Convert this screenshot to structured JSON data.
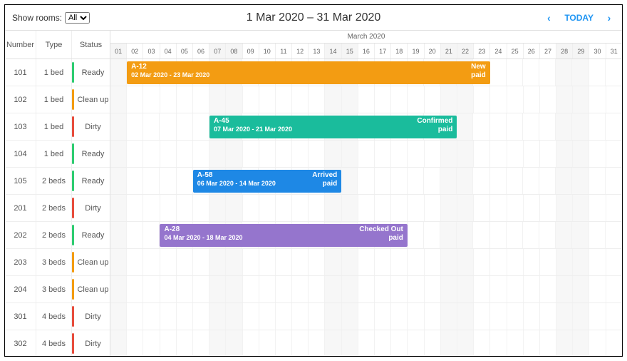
{
  "toolbar": {
    "filter_label": "Show rooms:",
    "filter_value": "All",
    "title": "1 Mar 2020 – 31 Mar 2020",
    "today_label": "TODAY"
  },
  "month_label": "March 2020",
  "columns": {
    "number": "Number",
    "type": "Type",
    "status": "Status"
  },
  "days": [
    {
      "d": "01",
      "we": true
    },
    {
      "d": "02",
      "we": false
    },
    {
      "d": "03",
      "we": false
    },
    {
      "d": "04",
      "we": false
    },
    {
      "d": "05",
      "we": false
    },
    {
      "d": "06",
      "we": false
    },
    {
      "d": "07",
      "we": true
    },
    {
      "d": "08",
      "we": true
    },
    {
      "d": "09",
      "we": false
    },
    {
      "d": "10",
      "we": false
    },
    {
      "d": "11",
      "we": false
    },
    {
      "d": "12",
      "we": false
    },
    {
      "d": "13",
      "we": false
    },
    {
      "d": "14",
      "we": true
    },
    {
      "d": "15",
      "we": true
    },
    {
      "d": "16",
      "we": false
    },
    {
      "d": "17",
      "we": false
    },
    {
      "d": "18",
      "we": false
    },
    {
      "d": "19",
      "we": false
    },
    {
      "d": "20",
      "we": false
    },
    {
      "d": "21",
      "we": true
    },
    {
      "d": "22",
      "we": true
    },
    {
      "d": "23",
      "we": false
    },
    {
      "d": "24",
      "we": false
    },
    {
      "d": "25",
      "we": false
    },
    {
      "d": "26",
      "we": false
    },
    {
      "d": "27",
      "we": false
    },
    {
      "d": "28",
      "we": true
    },
    {
      "d": "29",
      "we": true
    },
    {
      "d": "30",
      "we": false
    },
    {
      "d": "31",
      "we": false
    }
  ],
  "status_colors": {
    "Ready": "#2ecc71",
    "Clean up": "#f39c12",
    "Dirty": "#e74c3c"
  },
  "rooms": [
    {
      "number": "101",
      "type": "1 bed",
      "status": "Ready"
    },
    {
      "number": "102",
      "type": "1 bed",
      "status": "Clean up"
    },
    {
      "number": "103",
      "type": "1 bed",
      "status": "Dirty"
    },
    {
      "number": "104",
      "type": "1 bed",
      "status": "Ready"
    },
    {
      "number": "105",
      "type": "2 beds",
      "status": "Ready"
    },
    {
      "number": "201",
      "type": "2 beds",
      "status": "Dirty"
    },
    {
      "number": "202",
      "type": "2 beds",
      "status": "Ready"
    },
    {
      "number": "203",
      "type": "3 beds",
      "status": "Clean up"
    },
    {
      "number": "204",
      "type": "3 beds",
      "status": "Clean up"
    },
    {
      "number": "301",
      "type": "4 beds",
      "status": "Dirty"
    },
    {
      "number": "302",
      "type": "4 beds",
      "status": "Dirty"
    }
  ],
  "bookings": [
    {
      "room_index": 0,
      "start": 2,
      "end": 23,
      "id": "A-12",
      "dates": "02 Mar 2020 - 23 Mar 2020",
      "status": "New",
      "payment": "paid",
      "color": "#f39c12"
    },
    {
      "room_index": 2,
      "start": 7,
      "end": 21,
      "id": "A-45",
      "dates": "07 Mar 2020 - 21 Mar 2020",
      "status": "Confirmed",
      "payment": "paid",
      "color": "#1abc9c"
    },
    {
      "room_index": 4,
      "start": 6,
      "end": 14,
      "id": "A-58",
      "dates": "06 Mar 2020 - 14 Mar 2020",
      "status": "Arrived",
      "payment": "paid",
      "color": "#1e88e5"
    },
    {
      "room_index": 6,
      "start": 4,
      "end": 18,
      "id": "A-28",
      "dates": "04 Mar 2020 - 18 Mar 2020",
      "status": "Checked Out",
      "payment": "paid",
      "color": "#9575cd"
    }
  ]
}
